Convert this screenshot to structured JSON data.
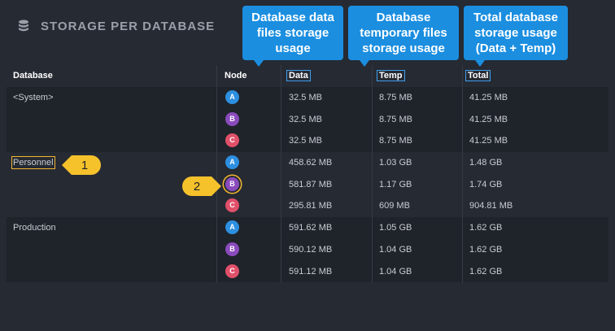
{
  "header": {
    "title": "STORAGE PER DATABASE",
    "icon": "database-icon"
  },
  "columns": {
    "database": "Database",
    "node": "Node",
    "data": "Data",
    "temp": "Temp",
    "total": "Total"
  },
  "callouts": {
    "data": "Database data files storage usage",
    "temp": "Database temporary files storage usage",
    "total": "Total database storage usage (Data + Temp)"
  },
  "markers": {
    "one": "1",
    "two": "2"
  },
  "colors": {
    "accent": "#1b8ee0",
    "highlight": "#f2b630",
    "node_a": "#2d8fe0",
    "node_b": "#8a4bbd",
    "node_c": "#e0506a"
  },
  "databases": [
    {
      "name": "<System>",
      "rows": [
        {
          "node": "A",
          "data": "32.5 MB",
          "temp": "8.75 MB",
          "total": "41.25 MB"
        },
        {
          "node": "B",
          "data": "32.5 MB",
          "temp": "8.75 MB",
          "total": "41.25 MB"
        },
        {
          "node": "C",
          "data": "32.5 MB",
          "temp": "8.75 MB",
          "total": "41.25 MB"
        }
      ]
    },
    {
      "name": "Personnel",
      "rows": [
        {
          "node": "A",
          "data": "458.62 MB",
          "temp": "1.03 GB",
          "total": "1.48 GB"
        },
        {
          "node": "B",
          "data": "581.87 MB",
          "temp": "1.17 GB",
          "total": "1.74 GB"
        },
        {
          "node": "C",
          "data": "295.81 MB",
          "temp": "609 MB",
          "total": "904.81 MB"
        }
      ]
    },
    {
      "name": "Production",
      "rows": [
        {
          "node": "A",
          "data": "591.62 MB",
          "temp": "1.05 GB",
          "total": "1.62 GB"
        },
        {
          "node": "B",
          "data": "590.12 MB",
          "temp": "1.04 GB",
          "total": "1.62 GB"
        },
        {
          "node": "C",
          "data": "591.12 MB",
          "temp": "1.04 GB",
          "total": "1.62 GB"
        }
      ]
    }
  ]
}
